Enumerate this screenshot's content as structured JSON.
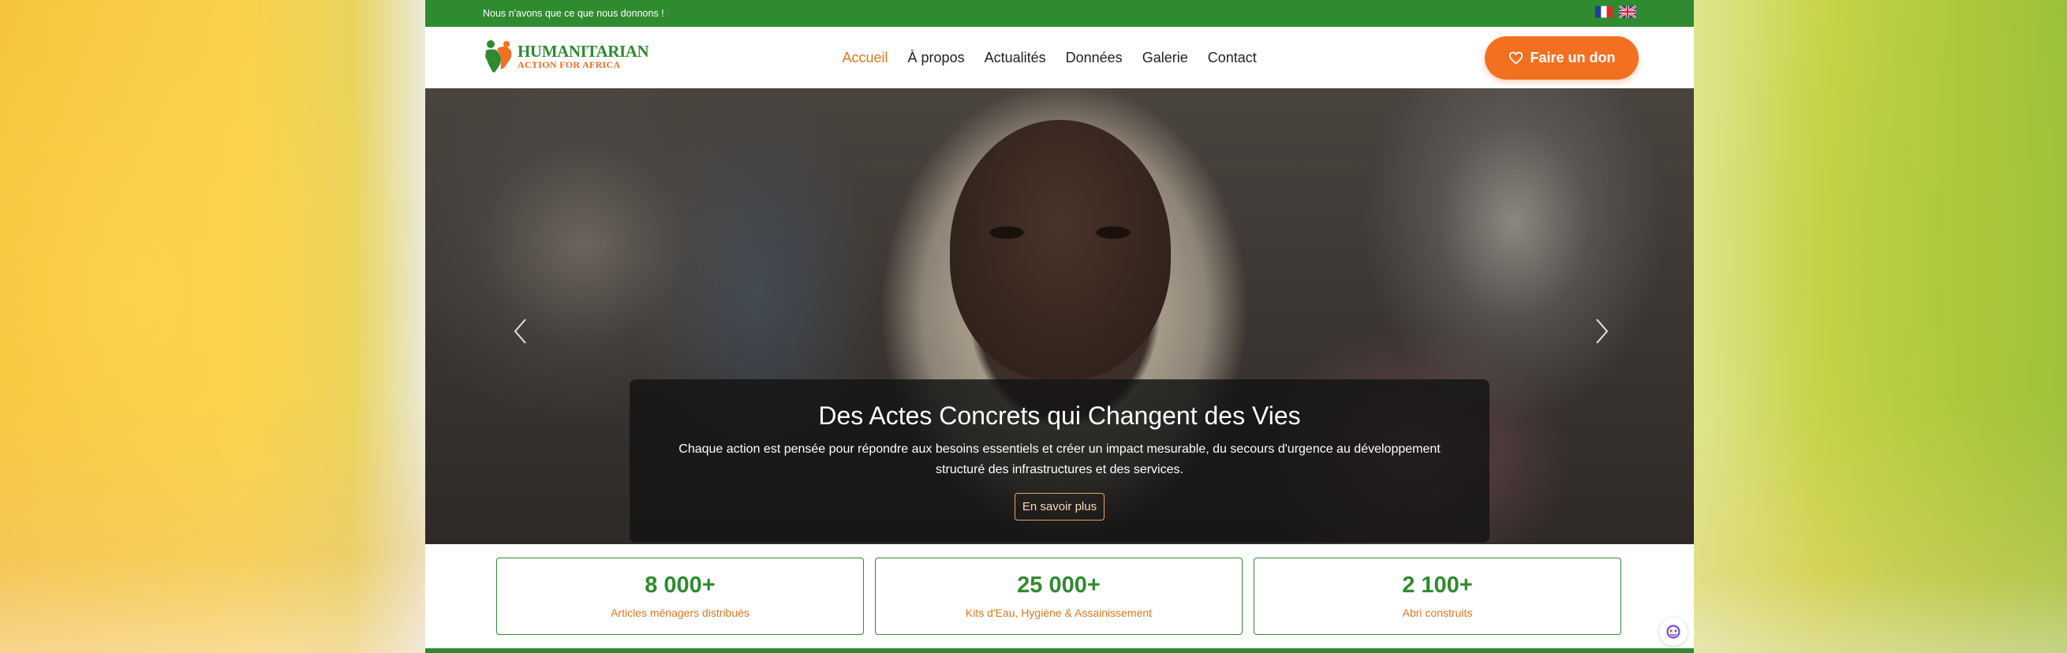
{
  "topbar": {
    "tagline": "Nous n'avons que ce que nous donnons !",
    "languages": [
      {
        "code": "fr",
        "icon": "france-flag-icon"
      },
      {
        "code": "en",
        "icon": "uk-flag-icon"
      }
    ]
  },
  "brand": {
    "title": "HUMANITARIAN",
    "subtitle": "ACTION FOR AFRICA",
    "green": "#2e8b2f",
    "orange": "#f37021"
  },
  "nav": {
    "items": [
      {
        "label": "Accueil",
        "active": true
      },
      {
        "label": "À propos",
        "active": false
      },
      {
        "label": "Actualités",
        "active": false
      },
      {
        "label": "Données",
        "active": false
      },
      {
        "label": "Galerie",
        "active": false
      },
      {
        "label": "Contact",
        "active": false
      }
    ],
    "donate_label": "Faire un don",
    "donate_icon": "heart-icon"
  },
  "hero": {
    "title": "Des Actes Concrets qui Changent des Vies",
    "text": "Chaque action est pensée pour répondre aux besoins essentiels et créer un impact mesurable, du secours d'urgence au développement structuré des infrastructures et des services.",
    "button_label": "En savoir plus",
    "prev_icon": "chevron-left-icon",
    "next_icon": "chevron-right-icon"
  },
  "stats": [
    {
      "value": "8 000+",
      "label": "Articles ménagers distribués"
    },
    {
      "value": "25 000+",
      "label": "Kits d'Eau, Hygiène & Assainissement"
    },
    {
      "value": "2 100+",
      "label": "Abri construits"
    }
  ],
  "widget": {
    "icon": "chat-assistant-icon"
  }
}
